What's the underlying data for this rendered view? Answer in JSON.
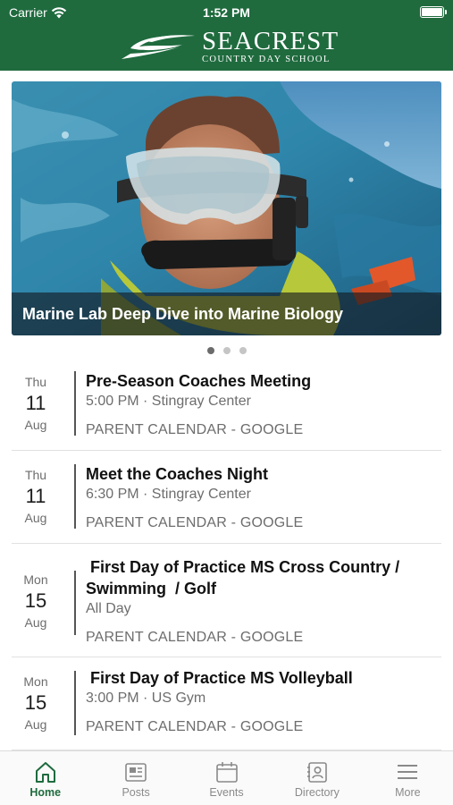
{
  "status_bar": {
    "carrier": "Carrier",
    "time": "1:52 PM"
  },
  "brand": {
    "name": "SEACREST",
    "subtitle": "COUNTRY DAY SCHOOL"
  },
  "hero": {
    "caption": "Marine Lab Deep Dive into Marine Biology"
  },
  "carousel": {
    "count": 3,
    "active_index": 0
  },
  "events": [
    {
      "dow": "Thu",
      "day": "11",
      "month": "Aug",
      "title": "Pre-Season Coaches Meeting",
      "subtitle": "5:00 PM · Stingray Center",
      "calendar": "PARENT CALENDAR - GOOGLE"
    },
    {
      "dow": "Thu",
      "day": "11",
      "month": "Aug",
      "title": "Meet the Coaches Night",
      "subtitle": "6:30 PM · Stingray Center",
      "calendar": "PARENT CALENDAR - GOOGLE"
    },
    {
      "dow": "Mon",
      "day": "15",
      "month": "Aug",
      "title": " First Day of Practice MS Cross Country / Swimming  / Golf",
      "subtitle": "All Day",
      "calendar": "PARENT CALENDAR - GOOGLE"
    },
    {
      "dow": "Mon",
      "day": "15",
      "month": "Aug",
      "title": " First Day of Practice MS Volleyball",
      "subtitle": "3:00 PM · US Gym",
      "calendar": "PARENT CALENDAR - GOOGLE"
    }
  ],
  "tabs": [
    {
      "label": "Home",
      "icon": "home-icon",
      "active": true
    },
    {
      "label": "Posts",
      "icon": "posts-icon",
      "active": false
    },
    {
      "label": "Events",
      "icon": "calendar-icon",
      "active": false
    },
    {
      "label": "Directory",
      "icon": "directory-icon",
      "active": false
    },
    {
      "label": "More",
      "icon": "menu-icon",
      "active": false
    }
  ],
  "colors": {
    "brand_green": "#1f6b3e",
    "tab_inactive": "#8a8a8a",
    "text_muted": "#6d6d6d"
  }
}
